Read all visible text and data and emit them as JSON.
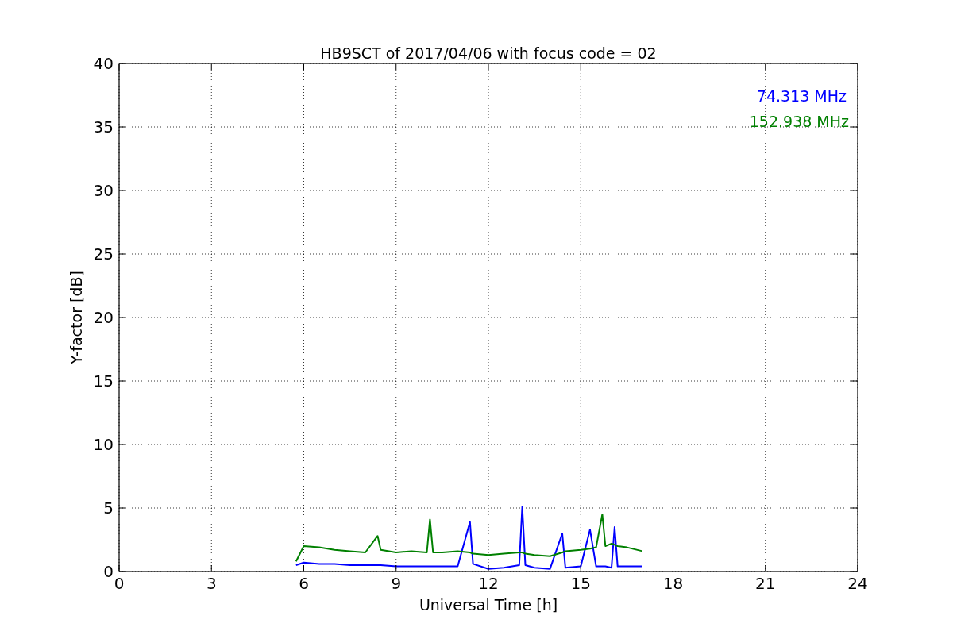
{
  "figure": {
    "chart_data": {
      "type": "line",
      "title": "HB9SCT of 2017/04/06 with focus code = 02",
      "xlabel": "Universal Time [h]",
      "ylabel": "Y-factor [dB]",
      "xlim": [
        0,
        24
      ],
      "ylim": [
        0,
        40
      ],
      "xticks": [
        0,
        3,
        6,
        9,
        12,
        15,
        18,
        21,
        24
      ],
      "yticks": [
        0,
        5,
        10,
        15,
        20,
        25,
        30,
        35,
        40
      ],
      "grid": true,
      "x": [
        5.75,
        6,
        6.5,
        7,
        7.5,
        8,
        8.4,
        8.5,
        9,
        9.5,
        10,
        10.1,
        10.2,
        10.5,
        11,
        11.4,
        11.5,
        12,
        12.5,
        13,
        13.1,
        13.2,
        13.5,
        14,
        14.4,
        14.5,
        15,
        15.3,
        15.5,
        15.7,
        15.8,
        16,
        16.1,
        16.2,
        16.5,
        17
      ],
      "series": [
        {
          "name": "74.313 MHz",
          "color": "#0000ff",
          "values": [
            0.5,
            0.7,
            0.6,
            0.6,
            0.5,
            0.5,
            0.5,
            0.5,
            0.4,
            0.4,
            0.4,
            0.4,
            0.4,
            0.4,
            0.4,
            3.9,
            0.6,
            0.2,
            0.3,
            0.5,
            5.1,
            0.5,
            0.3,
            0.2,
            3.0,
            0.3,
            0.4,
            3.3,
            0.4,
            0.4,
            0.4,
            0.3,
            3.5,
            0.4,
            0.4,
            0.4
          ]
        },
        {
          "name": "152.938 MHz",
          "color": "#008000",
          "values": [
            0.8,
            2.0,
            1.9,
            1.7,
            1.6,
            1.5,
            2.8,
            1.7,
            1.5,
            1.6,
            1.5,
            4.1,
            1.5,
            1.5,
            1.6,
            1.5,
            1.4,
            1.3,
            1.4,
            1.5,
            1.5,
            1.4,
            1.3,
            1.2,
            1.5,
            1.6,
            1.7,
            1.8,
            1.9,
            4.5,
            2.0,
            2.2,
            2.1,
            2.0,
            1.9,
            1.6
          ]
        }
      ]
    }
  }
}
